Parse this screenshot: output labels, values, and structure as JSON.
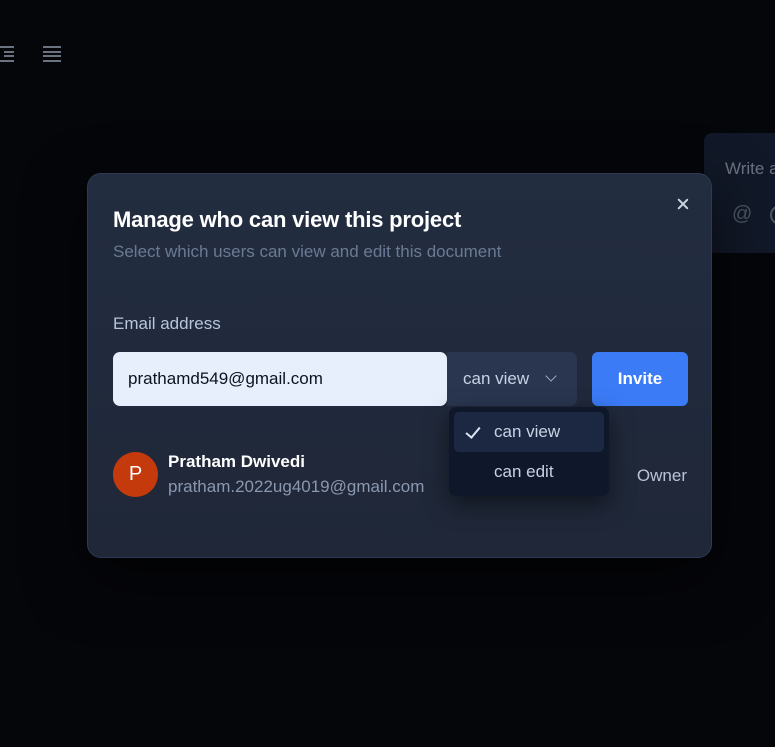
{
  "background": {
    "comment_placeholder": "Write a",
    "comment_mention_symbol": "@",
    "toolbar_icons": [
      "indent-icon",
      "align-justify-icon"
    ]
  },
  "modal": {
    "title": "Manage who can view this project",
    "subtitle": "Select which users can view and edit this document",
    "email_label": "Email address",
    "email_value": "prathamd549@gmail.com",
    "permission_selected": "can view",
    "invite_label": "Invite",
    "close_icon": "close-icon"
  },
  "dropdown": {
    "options": [
      {
        "label": "can view",
        "selected": true
      },
      {
        "label": "can edit",
        "selected": false
      }
    ]
  },
  "members": [
    {
      "initial": "P",
      "name": "Pratham Dwivedi",
      "email": "pratham.2022ug4019@gmail.com",
      "role": "Owner",
      "avatar_color": "#c43a0c"
    }
  ],
  "colors": {
    "accent": "#3b7bf6",
    "modal_bg": "#222d40",
    "page_bg": "#05060a"
  }
}
